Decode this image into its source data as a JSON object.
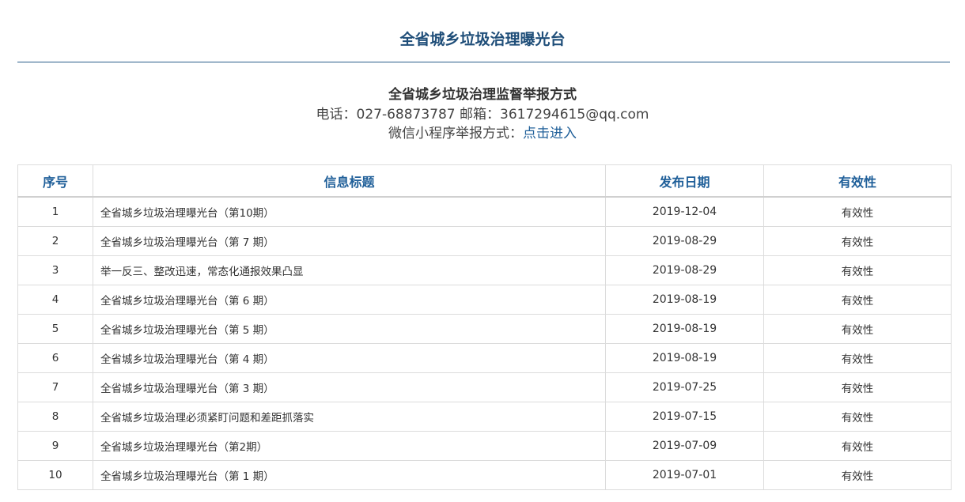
{
  "header": {
    "title": "全省城乡垃圾治理曝光台"
  },
  "contact": {
    "heading": "全省城乡垃圾治理监督举报方式",
    "phone_line": "电话：027-68873787 邮箱：3617294615@qq.com",
    "wechat_prefix": "微信小程序举报方式：",
    "wechat_link": "点击进入"
  },
  "table": {
    "columns": [
      "序号",
      "信息标题",
      "发布日期",
      "有效性"
    ],
    "rows": [
      {
        "no": "1",
        "title": "全省城乡垃圾治理曝光台（第10期）",
        "date": "2019-12-04",
        "validity": "有效性"
      },
      {
        "no": "2",
        "title": "全省城乡垃圾治理曝光台（第 7 期）",
        "date": "2019-08-29",
        "validity": "有效性"
      },
      {
        "no": "3",
        "title": "举一反三、整改迅速，常态化通报效果凸显",
        "date": "2019-08-29",
        "validity": "有效性"
      },
      {
        "no": "4",
        "title": "全省城乡垃圾治理曝光台（第 6 期）",
        "date": "2019-08-19",
        "validity": "有效性"
      },
      {
        "no": "5",
        "title": "全省城乡垃圾治理曝光台（第 5 期）",
        "date": "2019-08-19",
        "validity": "有效性"
      },
      {
        "no": "6",
        "title": "全省城乡垃圾治理曝光台（第 4 期）",
        "date": "2019-08-19",
        "validity": "有效性"
      },
      {
        "no": "7",
        "title": "全省城乡垃圾治理曝光台（第 3 期）",
        "date": "2019-07-25",
        "validity": "有效性"
      },
      {
        "no": "8",
        "title": "全省城乡垃圾治理必须紧盯问题和差距抓落实",
        "date": "2019-07-15",
        "validity": "有效性"
      },
      {
        "no": "9",
        "title": "全省城乡垃圾治理曝光台（第2期）",
        "date": "2019-07-09",
        "validity": "有效性"
      },
      {
        "no": "10",
        "title": "全省城乡垃圾治理曝光台（第 1 期）",
        "date": "2019-07-01",
        "validity": "有效性"
      }
    ]
  },
  "colors": {
    "accent": "#1f5f99",
    "title": "#1f4e79",
    "border": "#dcdcdc"
  }
}
